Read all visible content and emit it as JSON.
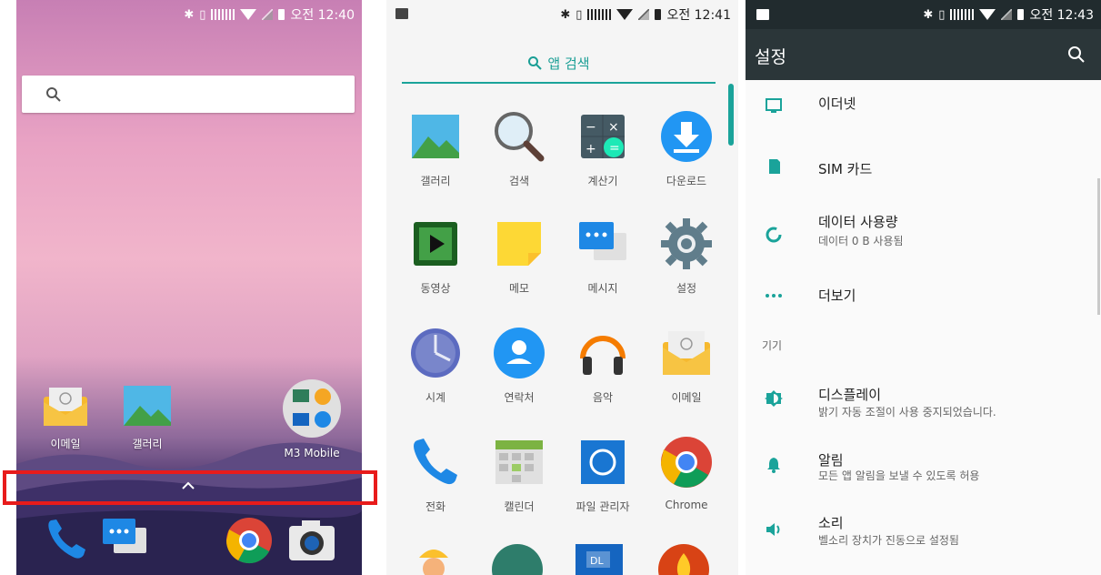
{
  "home": {
    "status_time": "오전 12:40",
    "apps": [
      {
        "label": "이메일",
        "icon": "email-icon"
      },
      {
        "label": "갤러리",
        "icon": "gallery-icon"
      },
      {
        "label": "M3 Mobile",
        "icon": "m3-mobile-folder-icon"
      }
    ],
    "dock": [
      "phone-icon",
      "messages-icon",
      "chrome-icon",
      "camera-icon"
    ]
  },
  "drawer": {
    "status_time": "오전 12:41",
    "search_label": "앱 검색",
    "apps": [
      "갤러리",
      "검색",
      "계산기",
      "다운로드",
      "동영상",
      "메모",
      "메시지",
      "설정",
      "시계",
      "연락처",
      "음악",
      "이메일",
      "전화",
      "캘린더",
      "파일 관리자",
      "Chrome"
    ]
  },
  "settings": {
    "status_time": "오전 12:43",
    "title": "설정",
    "items": [
      {
        "title": "이더넷",
        "subtitle": "",
        "icon": "ethernet-icon"
      },
      {
        "title": "SIM 카드",
        "subtitle": "",
        "icon": "sim-card-icon"
      },
      {
        "title": "데이터 사용량",
        "subtitle": "데이터 0 B 사용됨",
        "icon": "data-usage-icon"
      },
      {
        "title": "더보기",
        "subtitle": "",
        "icon": "more-icon"
      }
    ],
    "section_device": "기기",
    "device_items": [
      {
        "title": "디스플레이",
        "subtitle": "밝기 자동 조절이 사용 중지되었습니다.",
        "icon": "display-brightness-icon"
      },
      {
        "title": "알림",
        "subtitle": "모든 앱 알림을 보낼 수 있도록 허용",
        "icon": "notification-bell-icon"
      },
      {
        "title": "소리",
        "subtitle": "벨소리 장치가 진동으로 설정됨",
        "icon": "sound-icon"
      }
    ]
  },
  "colors": {
    "accent": "#1aa39a",
    "highlight": "#e81b1b",
    "toolbar": "#2b3639"
  }
}
